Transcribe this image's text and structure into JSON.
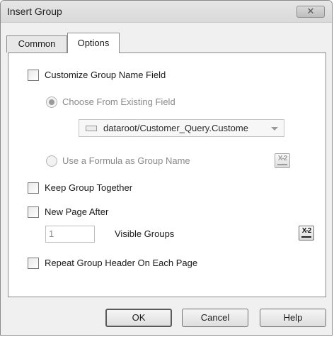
{
  "window": {
    "title": "Insert Group",
    "close_label": "✕"
  },
  "tabs": {
    "common_label": "Common",
    "options_label": "Options"
  },
  "options": {
    "customize_group_name_label": "Customize Group Name Field",
    "choose_from_existing_label": "Choose From Existing Field",
    "field_combo_value": "dataroot/Customer_Query.Custome",
    "use_formula_label": "Use a Formula as Group Name",
    "keep_group_together_label": "Keep Group Together",
    "new_page_after_label": "New Page After",
    "visible_groups_value": "1",
    "visible_groups_label": "Visible Groups",
    "repeat_header_label": "Repeat Group Header On Each Page"
  },
  "icons": {
    "formula_button_glyph": "X-2",
    "combo_icon": "field-icon",
    "combo_arrow": "chevron-down-icon"
  },
  "buttons": {
    "ok_label": "OK",
    "cancel_label": "Cancel",
    "help_label": "Help"
  }
}
